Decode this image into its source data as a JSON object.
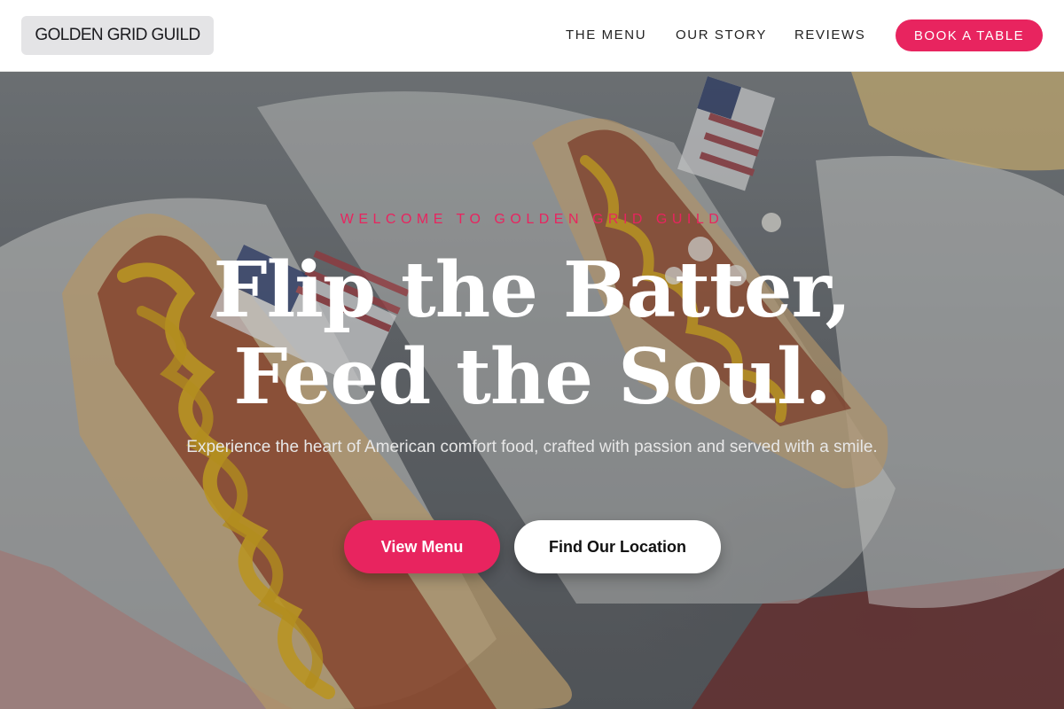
{
  "brand": {
    "name": "GOLDEN GRID GUILD"
  },
  "nav": {
    "links": [
      {
        "label": "THE MENU"
      },
      {
        "label": "OUR STORY"
      },
      {
        "label": "REVIEWS"
      }
    ],
    "cta_label": "BOOK A TABLE"
  },
  "hero": {
    "eyebrow": "WELCOME TO GOLDEN GRID GUILD",
    "headline_line1": "Flip the Batter,",
    "headline_line2": "Feed the Soul.",
    "subtext": "Experience the heart of American comfort food, crafted with passion and served with a smile.",
    "primary_button": "View Menu",
    "secondary_button": "Find Our Location",
    "background_image": "hot-dogs-with-mustard-and-american-flags"
  },
  "colors": {
    "accent": "#e8245f",
    "nav_background": "#ffffff",
    "logo_background": "#e4e4e6",
    "headline": "#ffffff"
  }
}
